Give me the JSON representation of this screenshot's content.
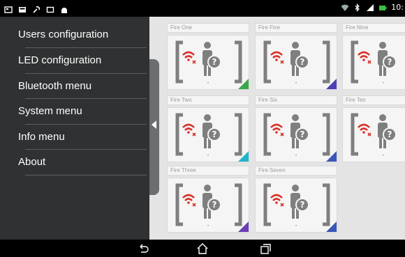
{
  "status_bar": {
    "time": "10:",
    "left_icons": [
      "screenshot-icon",
      "image-icon",
      "wrench-icon",
      "square-icon",
      "android-icon"
    ],
    "right_icons": [
      "wifi-icon",
      "bluetooth-icon",
      "signal-icon",
      "battery-icon"
    ]
  },
  "drawer": {
    "items": [
      {
        "label": "Users configuration"
      },
      {
        "label": "LED configuration"
      },
      {
        "label": "Bluetooth menu"
      },
      {
        "label": "System menu"
      },
      {
        "label": "Info menu"
      },
      {
        "label": "About"
      }
    ]
  },
  "tiles": [
    {
      "title": "Fire One",
      "status": "-",
      "corner_color": "#3aa84a"
    },
    {
      "title": "Fire Five",
      "status": "-",
      "corner_color": "#4a3fb5"
    },
    {
      "title": "Fire Nine",
      "status": "-",
      "corner_color": ""
    },
    {
      "title": "Fire Two",
      "status": "-",
      "corner_color": "#1fb5c9"
    },
    {
      "title": "Fire Six",
      "status": "-",
      "corner_color": "#3a56b8"
    },
    {
      "title": "Fire Ten",
      "status": "-",
      "corner_color": ""
    },
    {
      "title": "Fire Three",
      "status": "-",
      "corner_color": "#6a3fb5"
    },
    {
      "title": "Fire Seven",
      "status": "-",
      "corner_color": "#3a56b8"
    }
  ],
  "colors": {
    "drawer_bg": "#2f3132",
    "grid_bg": "#e4e4e4",
    "wifi_off_red": "#d8322a",
    "icon_gray": "#7f7f7f"
  },
  "nav": {
    "buttons": [
      "back-icon",
      "home-icon",
      "recents-icon"
    ]
  }
}
